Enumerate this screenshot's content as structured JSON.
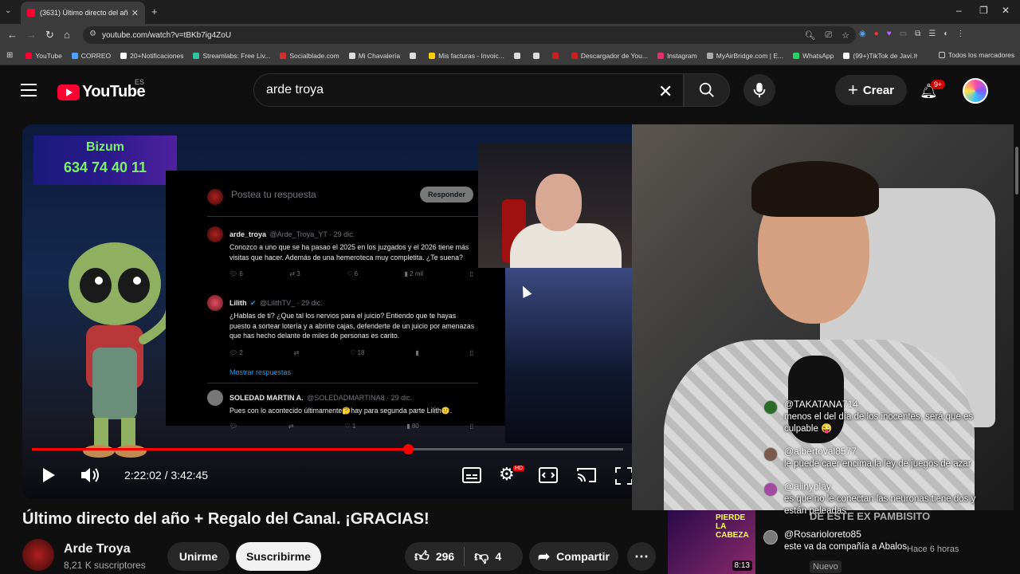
{
  "browser": {
    "tab_title": "(3631) Último directo del año -",
    "url": "youtube.com/watch?v=tBKb7ig4ZoU",
    "bookmarks": [
      {
        "label": "YouTube",
        "color": "#ff0033"
      },
      {
        "label": "CORREO",
        "color": "#4aa3ff"
      },
      {
        "label": "20+Notificaciones",
        "color": "#ffffff"
      },
      {
        "label": "Streamlabs: Free Liv...",
        "color": "#31c3a2"
      },
      {
        "label": "Socialblade.com",
        "color": "#d03030"
      },
      {
        "label": "Mi Chavalería",
        "color": "#dddddd"
      },
      {
        "label": "",
        "color": "#dddddd"
      },
      {
        "label": "Mis facturas - Invoic...",
        "color": "#ffcc00"
      },
      {
        "label": "",
        "color": "#dddddd"
      },
      {
        "label": "",
        "color": "#dddddd"
      },
      {
        "label": "",
        "color": "#cc2020"
      },
      {
        "label": "Descargador de You...",
        "color": "#cc2020"
      },
      {
        "label": "Instagram",
        "color": "#e1306c"
      },
      {
        "label": "MyAirBridge.com | E...",
        "color": "#aaaaaa"
      },
      {
        "label": "WhatsApp",
        "color": "#25d366"
      },
      {
        "label": "(99+)TikTok de Javi...",
        "color": "#ffffff"
      }
    ],
    "all_bookmarks": "Todos los marcadores"
  },
  "header": {
    "logo_word": "YouTube",
    "country": "ES",
    "search_value": "arde troya",
    "create_label": "Crear",
    "notifications_badge": "9+"
  },
  "video": {
    "bizum_title": "Bizum",
    "bizum_number": "634 74 40 11",
    "reply_placeholder": "Postea tu respuesta",
    "reply_button": "Responder",
    "tweets": [
      {
        "name": "arde_troya",
        "handle": "@Arde_Troya_YT · 29 dic.",
        "text": "Conozco a uno que se ha pasao el 2025 en los juzgados y el 2026 tiene más visitas que hacer. Además de una hemeroteca muy completita. ¿Te suena?",
        "replies": "6",
        "retweets": "3",
        "likes": "6",
        "views": "2 mil"
      },
      {
        "name": "Lilith",
        "handle": "@LilithTV_ · 29 dic.",
        "text": "¿Hablas de ti? ¿Que tal los nervios para el juicio? Entiendo que te hayas puesto a sortear lotería y a abrirte cajas, defenderte de un juicio por amenazas que has hecho delante de miles de personas es carito.",
        "replies": "2",
        "retweets": "",
        "likes": "18",
        "views": ""
      },
      {
        "name": "SOLEDAD MARTIN A.",
        "handle": "@SOLEDADMARTINA8 · 29 dic.",
        "text": "Pues con lo acontecido últimamente🤔hay para segunda parte Lilith🙂.",
        "replies": "",
        "retweets": "",
        "likes": "1",
        "views": "80"
      }
    ],
    "show_replies": "Mostrar respuestas",
    "current_time": "2:22:02",
    "duration": "3:42:45",
    "time_display": "2:22:02 / 3:42:45",
    "progress_fraction": 0.6364,
    "progress_color": "#ff0000"
  },
  "chat": [
    {
      "user": "@TAKATANA714",
      "msg": "menos el del día de los inocentes, será que es culpable 😜"
    },
    {
      "user": "@albertoval8577",
      "msg": "le puede caer encima la ley de juegos de azar"
    },
    {
      "user": "@aiinyplay",
      "msg": "es que no le conectan las neuronas tiene dos y están peleadas"
    },
    {
      "user": "@Rosarioloreto85",
      "msg": "este va da compañía a Abalos"
    }
  ],
  "below": {
    "title": "Último directo del año + Regalo del Canal. ¡GRACIAS!",
    "channel_name": "Arde Troya",
    "subscribers": "8,21 K suscriptores",
    "join_label": "Unirme",
    "subscribe_label": "Suscribirme",
    "likes": "296",
    "dislikes": "4",
    "share_label": "Compartir"
  },
  "sidebar_video": {
    "thumb_text": "PIERDE LA CABEZA",
    "title": "DE ESTE EX PAMBISITO",
    "duration": "8:13",
    "meta": "Hace 6 horas",
    "badge": "Nuevo"
  }
}
